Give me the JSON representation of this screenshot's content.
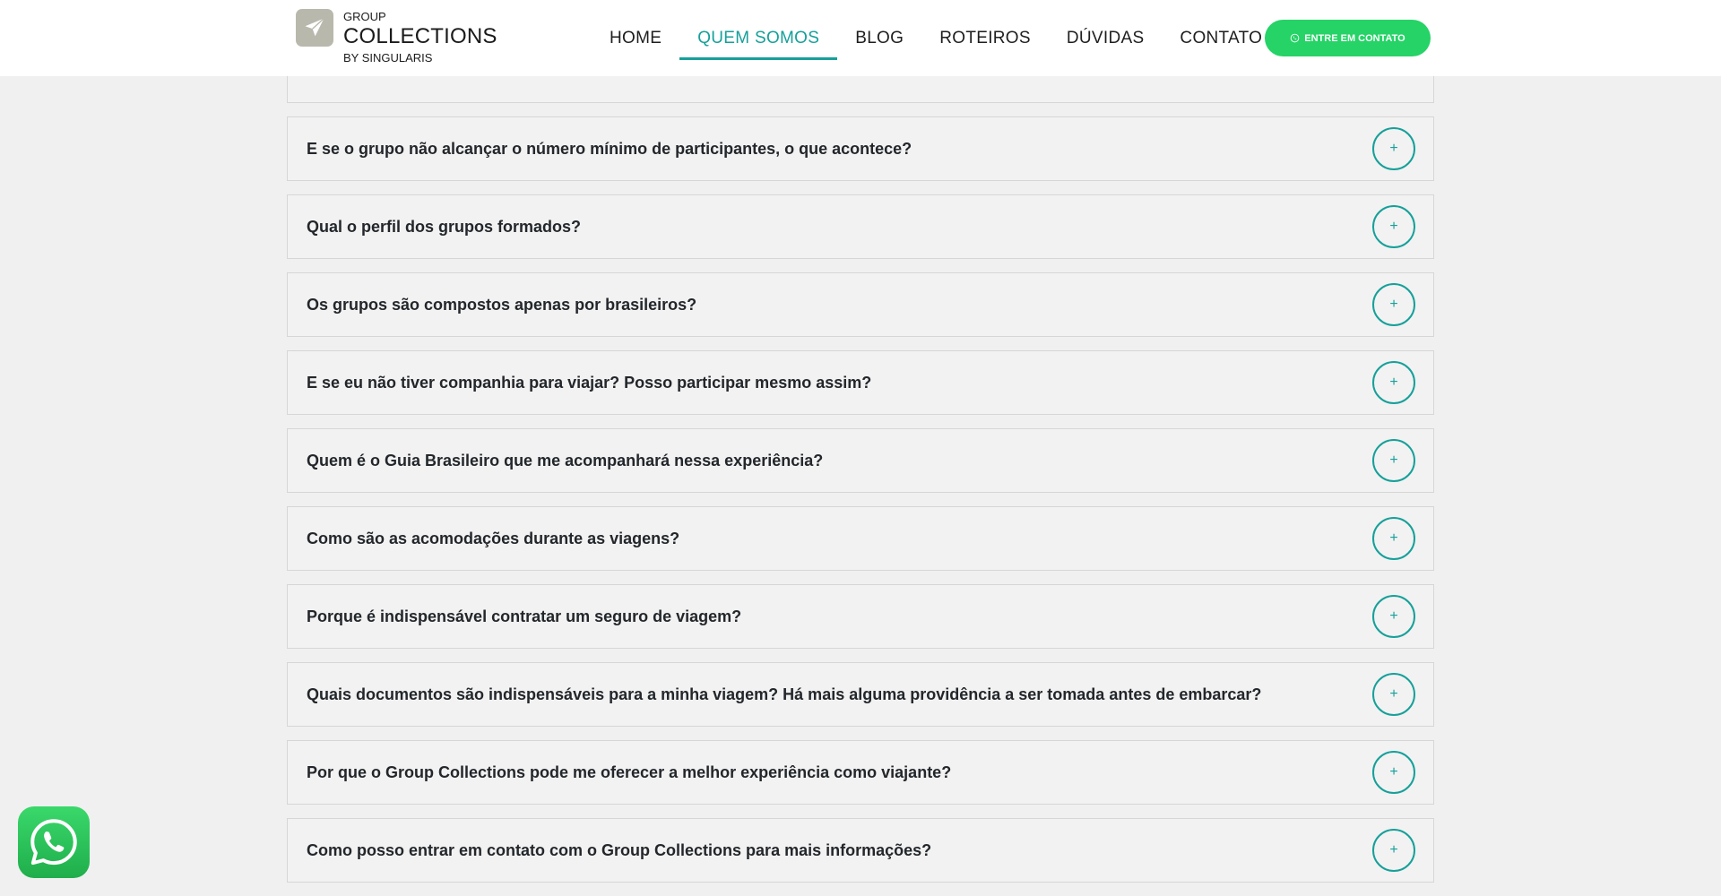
{
  "header": {
    "logo": {
      "top": "GROUP",
      "main": "COLLECTIONS",
      "bottom": "BY SINGULARIS"
    },
    "nav": [
      {
        "label": "HOME",
        "active": false
      },
      {
        "label": "QUEM SOMOS",
        "active": true
      },
      {
        "label": "BLOG",
        "active": false
      },
      {
        "label": "ROTEIROS",
        "active": false
      },
      {
        "label": "DÚVIDAS",
        "active": false
      },
      {
        "label": "CONTATO",
        "active": false
      }
    ],
    "cta_label": "ENTRE EM CONTATO"
  },
  "faq": {
    "toggle_symbol": "+",
    "items": [
      {
        "question": ""
      },
      {
        "question": "E se o grupo não alcançar o número mínimo de participantes, o que acontece?"
      },
      {
        "question": "Qual o perfil dos grupos formados?"
      },
      {
        "question": "Os grupos são compostos apenas por brasileiros?"
      },
      {
        "question": "E se eu não tiver companhia para viajar? Posso participar mesmo assim?"
      },
      {
        "question": "Quem é o Guia Brasileiro que me acompanhará nessa experiência?"
      },
      {
        "question": "Como são as acomodações durante as viagens?"
      },
      {
        "question": "Porque é indispensável contratar um seguro de viagem?"
      },
      {
        "question": "Quais documentos são indispensáveis para a minha viagem? Há mais alguma providência a ser tomada antes de embarcar?"
      },
      {
        "question": "Por que o Group Collections pode me oferecer a melhor experiência como viajante?"
      },
      {
        "question": "Como posso entrar em contato com o Group Collections para mais informações?"
      }
    ]
  },
  "colors": {
    "accent": "#16a09a",
    "whatsapp": "#25d366",
    "background": "#f0f0f0",
    "logo_mark": "#b9b8ac"
  },
  "icons": {
    "logo": "airplane-icon",
    "cta": "whatsapp-icon",
    "float": "whatsapp-icon",
    "toggle": "plus-icon"
  }
}
